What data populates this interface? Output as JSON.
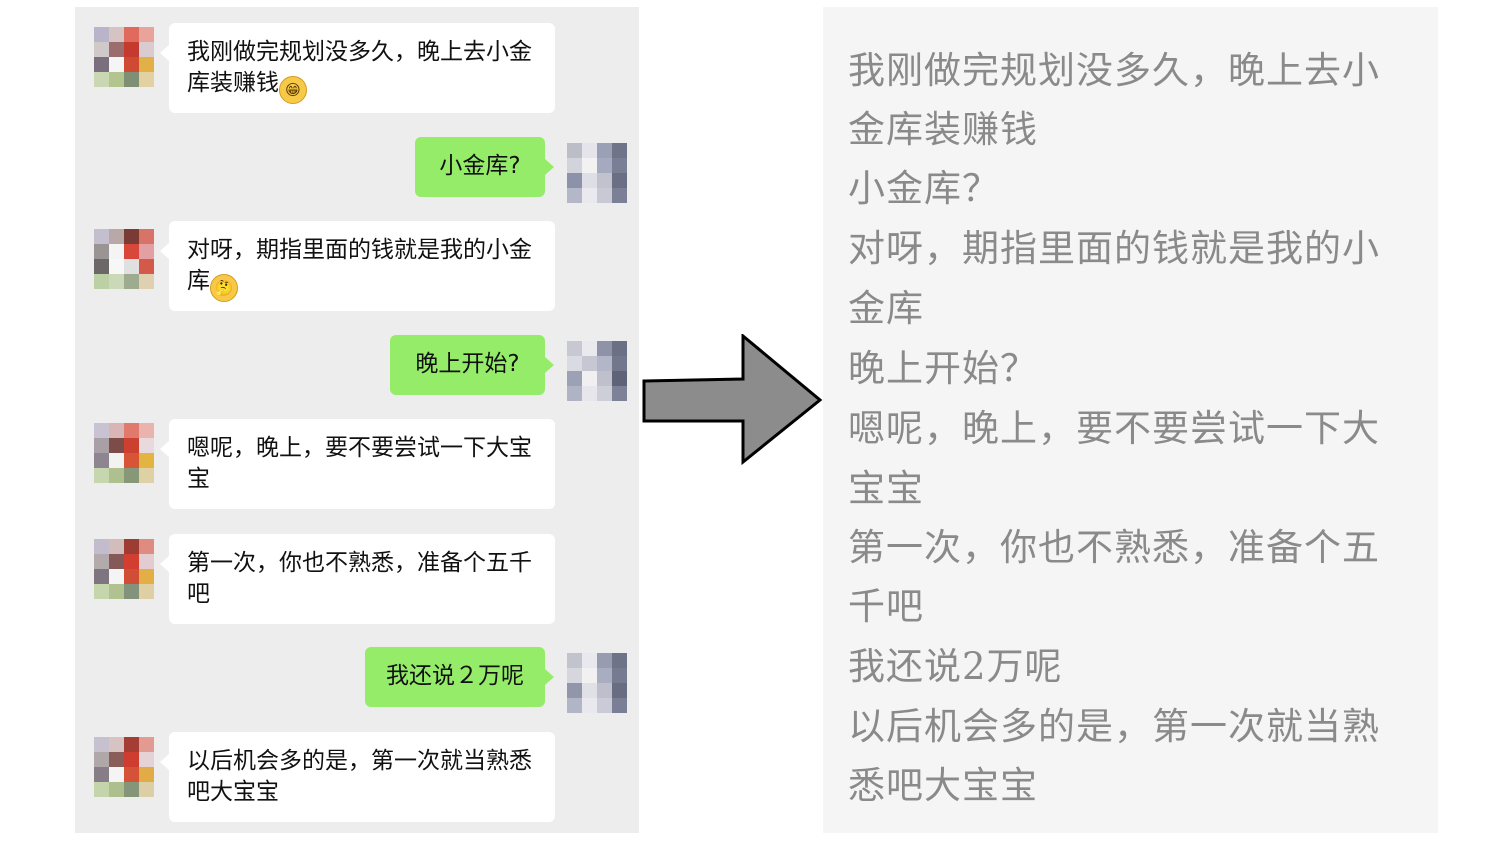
{
  "chat": {
    "messages": [
      {
        "side": "incoming",
        "text": "我刚做完规划没多久，晚上去小金库装赚钱",
        "emoji": "grinning-face-emoji"
      },
      {
        "side": "outgoing",
        "text": "小金库?"
      },
      {
        "side": "incoming",
        "text": "对呀，期指里面的钱就是我的小金库",
        "emoji": "thinking-face-emoji"
      },
      {
        "side": "outgoing",
        "text": "晚上开始?"
      },
      {
        "side": "incoming",
        "text": "嗯呢，晚上，要不要尝试一下大宝宝"
      },
      {
        "side": "incoming",
        "text": "第一次，你也不熟悉，准备个五千吧"
      },
      {
        "side": "outgoing",
        "text": "我还说２万呢"
      },
      {
        "side": "incoming",
        "text": "以后机会多的是，第一次就当熟悉吧大宝宝"
      }
    ],
    "colors": {
      "background": "#ededed",
      "incoming_bubble": "#ffffff",
      "outgoing_bubble": "#95ec69"
    }
  },
  "arrow": {
    "icon": "right-arrow-icon",
    "fill": "#8c8c8c"
  },
  "transcript": {
    "lines": [
      "我刚做完规划没多久，晚上去小",
      "金库装赚钱",
      "小金库？",
      "对呀，期指里面的钱就是我的小",
      "金库",
      "晚上开始？",
      "嗯呢，晚上，要不要尝试一下大",
      "宝宝",
      "第一次，你也不熟悉，准备个五",
      "千吧",
      "我还说2万呢",
      "以后机会多的是，第一次就当熟",
      "悉吧大宝宝"
    ],
    "text_color": "#8a8a8a",
    "background": "#f5f5f5"
  }
}
